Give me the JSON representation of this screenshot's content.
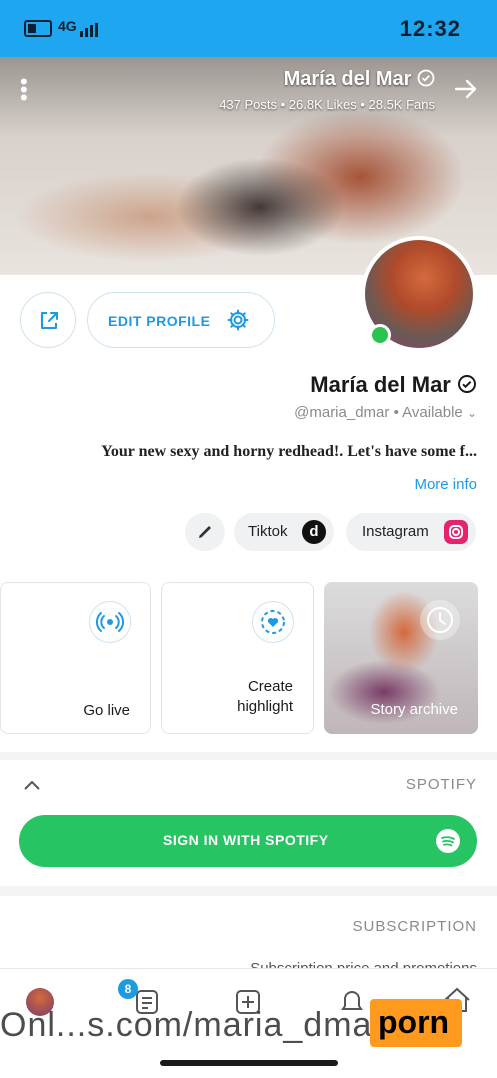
{
  "status_bar": {
    "time": "12:32",
    "network": "4G"
  },
  "cover": {
    "title": "María del Mar",
    "stats": "437 Posts  •  26.8K Likes  •  28.5K Fans"
  },
  "profile": {
    "edit_profile_label": "EDIT PROFILE",
    "name": "María del Mar",
    "handle": "@maria_dmar",
    "status": "Available",
    "bio": "Your new sexy and horny redhead!. Let's have some f...",
    "more_info": "More info"
  },
  "chips": {
    "instagram": "Instagram",
    "tiktok": "Tiktok"
  },
  "highlights": {
    "story_archive": "Story archive",
    "create_line1": "Create",
    "create_line2": "highlight",
    "go_live": "Go live"
  },
  "spotify": {
    "section_title": "SPOTIFY",
    "button_label": "SIGN IN WITH SPOTIFY"
  },
  "subscription": {
    "section_title": "SUBSCRIPTION",
    "text": "Subscription price and promotions"
  },
  "bottom_nav": {
    "badge": "8"
  },
  "overlay": {
    "watermark": "Onl...s.com/maria_dmar",
    "logo": "porn"
  },
  "colors": {
    "accent": "#1e9ae0",
    "spotify": "#27c464",
    "status_bar": "#1ea6f0",
    "online": "#2ac350"
  }
}
